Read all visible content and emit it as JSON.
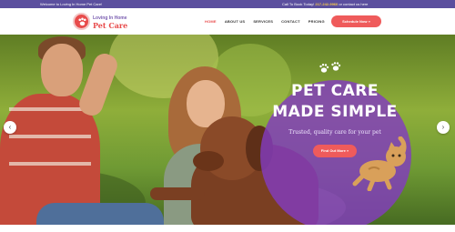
{
  "topbar": {
    "welcome": "Welcome to Loving In Home Pet Care!",
    "call_prefix": "Call To Book Today!",
    "phone": "217-242-9960",
    "call_suffix": "or contact us here"
  },
  "logo": {
    "line1": "Loving In Home",
    "line2": "Pet Care"
  },
  "nav": {
    "items": [
      {
        "label": "HOME",
        "active": true
      },
      {
        "label": "ABOUT US",
        "active": false
      },
      {
        "label": "SERVICES",
        "active": false
      },
      {
        "label": "CONTACT",
        "active": false
      },
      {
        "label": "PRICING",
        "active": false
      }
    ],
    "cta": "Schedule Now »"
  },
  "hero": {
    "headline1": "PET CARE",
    "headline2": "MADE SIMPLE",
    "tagline": "Trusted, quality care for your pet",
    "cta": "Find Out More »",
    "paws_icon": "paw-prints-icon",
    "prev_arrow": "‹",
    "next_arrow": "›"
  },
  "colors": {
    "brand_purple": "#5b4f9e",
    "accent_red": "#ef5b5b",
    "overlay_purple": "#823cbe",
    "phone_yellow": "#f5c84b"
  }
}
